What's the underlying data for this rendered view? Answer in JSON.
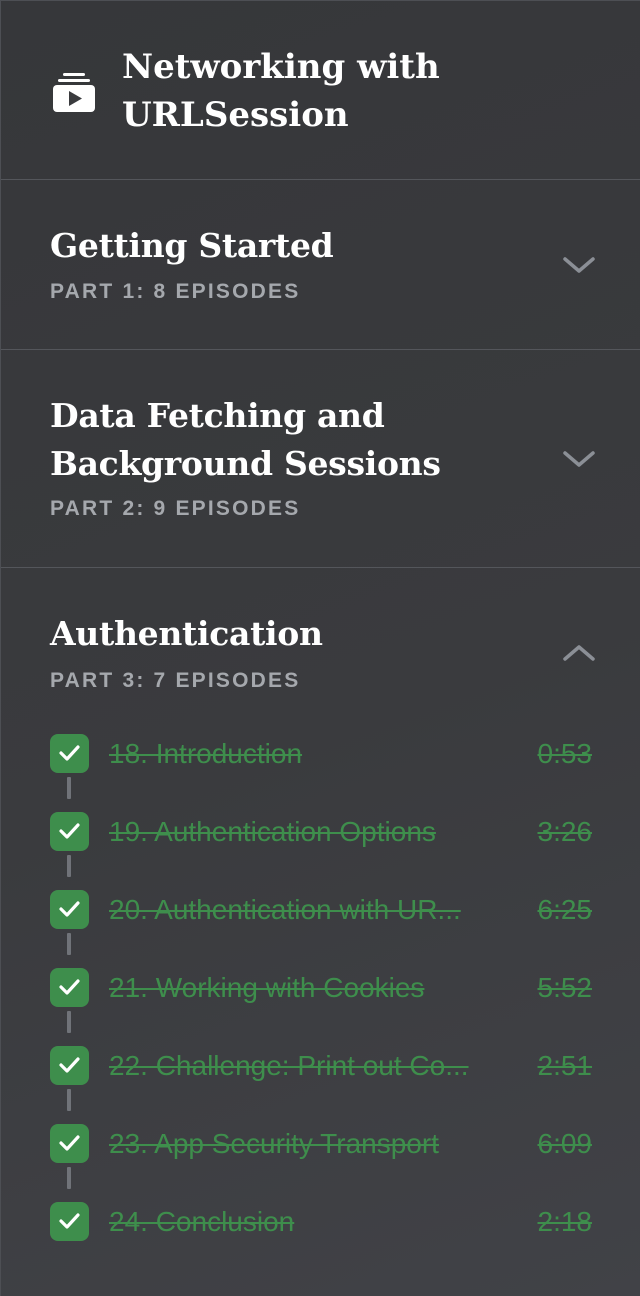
{
  "course": {
    "title": "Networking with URLSession",
    "icon": "video-course-icon"
  },
  "sections": [
    {
      "title": "Getting Started",
      "subtitle": "PART 1: 8 EPISODES",
      "expanded": false,
      "chevron": "chevron-down-icon"
    },
    {
      "title": "Data Fetching and Background Sessions",
      "subtitle": "PART 2: 9 EPISODES",
      "expanded": false,
      "chevron": "chevron-down-icon"
    },
    {
      "title": "Authentication",
      "subtitle": "PART 3: 7 EPISODES",
      "expanded": true,
      "chevron": "chevron-up-icon",
      "episodes": [
        {
          "title": "18. Introduction",
          "duration": "0:53",
          "completed": true
        },
        {
          "title": "19. Authentication Options",
          "duration": "3:26",
          "completed": true
        },
        {
          "title": "20. Authentication with UR...",
          "duration": "6:25",
          "completed": true
        },
        {
          "title": "21. Working with Cookies",
          "duration": "5:52",
          "completed": true
        },
        {
          "title": "22. Challenge: Print out Co...",
          "duration": "2:51",
          "completed": true
        },
        {
          "title": "23. App Security Transport",
          "duration": "6:09",
          "completed": true
        },
        {
          "title": "24. Conclusion",
          "duration": "2:18",
          "completed": true
        }
      ]
    }
  ],
  "colors": {
    "background": "#3a3b3e",
    "completed": "#3e8e4c",
    "subtitle": "#a5a8ad",
    "divider": "#54565b",
    "connector": "#707379"
  }
}
